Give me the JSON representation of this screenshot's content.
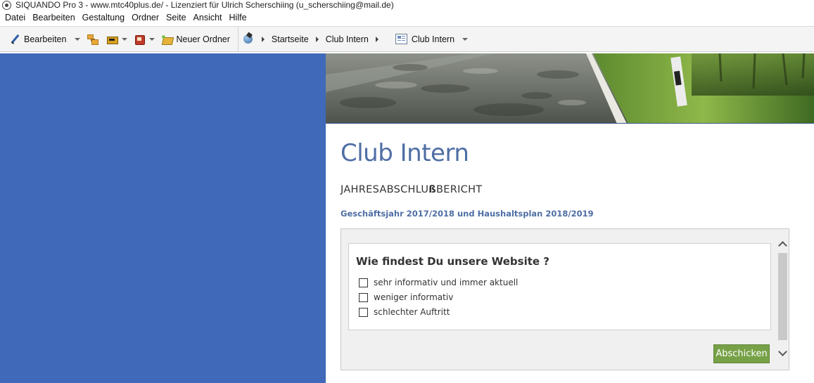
{
  "window": {
    "title": "SIQUANDO Pro 3 - www.mtc40plus.de/ - Lizenziert für Ulrich Scherschiing (u_scherschiing@mail.de)"
  },
  "menu": {
    "items": [
      "Datei",
      "Bearbeiten",
      "Gestaltung",
      "Ordner",
      "Seite",
      "Ansicht",
      "Hilfe"
    ]
  },
  "toolbar": {
    "edit_label": "Bearbeiten",
    "new_folder_label": "Neuer Ordner",
    "icons": [
      "pencil-icon",
      "tree-icon",
      "folder-image-icon",
      "book-icon",
      "new-folder-icon"
    ]
  },
  "breadcrumb": {
    "items": [
      "Startseite",
      "Club Intern"
    ],
    "current_page": "Club Intern"
  },
  "colors": {
    "left_panel": "#4169b9",
    "heading": "#4e6ea5",
    "submit_button": "#77a146"
  },
  "page": {
    "heading": "Club Intern",
    "subheading_pre": "JAHRESABSCHLU",
    "subheading_bold": "ß",
    "subheading_post": "BERICHT",
    "link_text": "Geschäftsjahr 2017/2018 und Haushaltsplan 2018/2019"
  },
  "survey": {
    "question": "Wie findest Du unsere Website ?",
    "options": [
      "sehr informativ und immer aktuell",
      "weniger informativ",
      "schlechter Auftritt"
    ],
    "submit_label": "Abschicken"
  }
}
